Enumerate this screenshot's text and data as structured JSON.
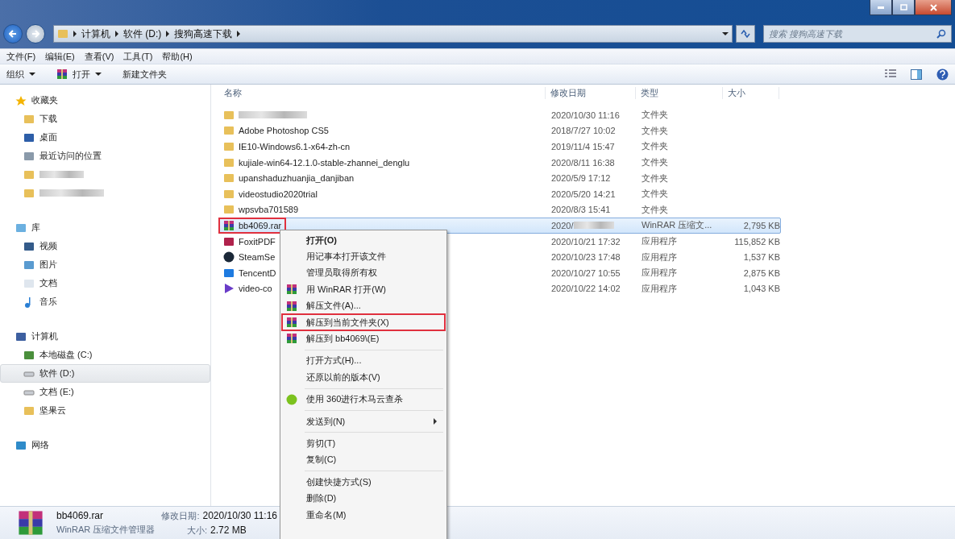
{
  "window": {
    "breadcrumb": [
      "计算机",
      "软件 (D:)",
      "搜狗高速下载"
    ],
    "search_placeholder": "搜索 搜狗高速下载"
  },
  "menu_bar": [
    "文件(F)",
    "编辑(E)",
    "查看(V)",
    "工具(T)",
    "帮助(H)"
  ],
  "toolbar": [
    {
      "label": "组织",
      "kind": "menu"
    },
    {
      "label": "打开",
      "kind": "menu"
    },
    {
      "label": "新建文件夹",
      "kind": "button"
    }
  ],
  "sidebar": [
    {
      "label": "收藏夹",
      "items": [
        {
          "label": "下载",
          "selected": false
        },
        {
          "label": "桌面",
          "selected": false
        },
        {
          "label": "最近访问的位置",
          "selected": false
        },
        {
          "selected": false
        },
        {
          "selected": false
        }
      ]
    },
    {
      "label": "库",
      "items": [
        {
          "label": "视频",
          "selected": false
        },
        {
          "label": "图片",
          "selected": false
        },
        {
          "label": "文档",
          "selected": false
        },
        {
          "label": "音乐",
          "selected": false
        }
      ]
    },
    {
      "label": "计算机",
      "items": [
        {
          "label": "本地磁盘 (C:)",
          "selected": false
        },
        {
          "label": "软件 (D:)",
          "selected": true
        },
        {
          "label": "文档 (E:)",
          "selected": false
        },
        {
          "label": "坚果云",
          "selected": false
        }
      ]
    },
    {
      "label": "网络"
    }
  ],
  "columns": [
    "名称",
    "修改日期",
    "类型",
    "大小"
  ],
  "rows": [
    {
      "date": "2020/10/30 11:16",
      "type": "文件夹",
      "selected": false,
      "annotated": false
    },
    {
      "name": "Adobe Photoshop CS5",
      "date": "2018/7/27 10:02",
      "type": "文件夹",
      "selected": false,
      "annotated": false
    },
    {
      "name": "IE10-Windows6.1-x64-zh-cn",
      "date": "2019/11/4 15:47",
      "type": "文件夹",
      "selected": false,
      "annotated": false
    },
    {
      "name": "kujiale-win64-12.1.0-stable-zhannei_denglu",
      "date": "2020/8/11 16:38",
      "type": "文件夹",
      "selected": false,
      "annotated": false
    },
    {
      "name": "upanshaduzhuanjia_danjiban",
      "date": "2020/5/9 17:12",
      "type": "文件夹",
      "selected": false,
      "annotated": false
    },
    {
      "name": "videostudio2020trial",
      "date": "2020/5/20 14:21",
      "type": "文件夹",
      "selected": false,
      "annotated": false
    },
    {
      "name": "wpsvba701589",
      "date": "2020/8/3 15:41",
      "type": "文件夹",
      "selected": false,
      "annotated": false
    },
    {
      "name": "bb4069.rar",
      "date": "2020/",
      "date_redacted": true,
      "type": "WinRAR 压缩文...",
      "size": "2,795 KB",
      "selected": true,
      "annotated": true
    },
    {
      "name": "FoxitPDF",
      "date": "2020/10/21 17:32",
      "type": "应用程序",
      "size": "115,852 KB",
      "selected": false,
      "annotated": false
    },
    {
      "name": "SteamSe",
      "date": "2020/10/23 17:48",
      "type": "应用程序",
      "size": "1,537 KB",
      "selected": false,
      "annotated": false
    },
    {
      "name": "TencentD",
      "date": "2020/10/27 10:55",
      "type": "应用程序",
      "size": "2,875 KB",
      "selected": false,
      "annotated": false
    },
    {
      "name": "video-co",
      "date": "2020/10/22 14:02",
      "type": "应用程序",
      "size": "1,043 KB",
      "selected": false,
      "annotated": false
    }
  ],
  "context_menu": [
    {
      "kind": "item",
      "label": "打开(O)",
      "bold": true
    },
    {
      "kind": "item",
      "label": "用记事本打开该文件"
    },
    {
      "kind": "item",
      "label": "管理员取得所有权"
    },
    {
      "kind": "item",
      "label": "用 WinRAR 打开(W)"
    },
    {
      "kind": "item",
      "label": "解压文件(A)..."
    },
    {
      "kind": "item",
      "label": "解压到当前文件夹(X)",
      "annotated": true
    },
    {
      "kind": "item",
      "label": "解压到 bb4069\\(E)"
    },
    {
      "kind": "separator"
    },
    {
      "kind": "item",
      "label": "打开方式(H)..."
    },
    {
      "kind": "item",
      "label": "还原以前的版本(V)"
    },
    {
      "kind": "separator"
    },
    {
      "kind": "item",
      "label": "使用 360进行木马云查杀"
    },
    {
      "kind": "separator"
    },
    {
      "kind": "item",
      "label": "发送到(N)",
      "submenu": true
    },
    {
      "kind": "separator"
    },
    {
      "kind": "item",
      "label": "剪切(T)"
    },
    {
      "kind": "item",
      "label": "复制(C)"
    },
    {
      "kind": "separator"
    },
    {
      "kind": "item",
      "label": "创建快捷方式(S)"
    },
    {
      "kind": "item",
      "label": "删除(D)"
    },
    {
      "kind": "item",
      "label": "重命名(M)"
    }
  ],
  "details": {
    "name": "bb4069.rar",
    "subtitle": "WinRAR 压缩文件管理器",
    "date_label": "修改日期:",
    "date": "2020/10/30 11:16",
    "size_label": "大小:",
    "size": "2.72 MB"
  }
}
